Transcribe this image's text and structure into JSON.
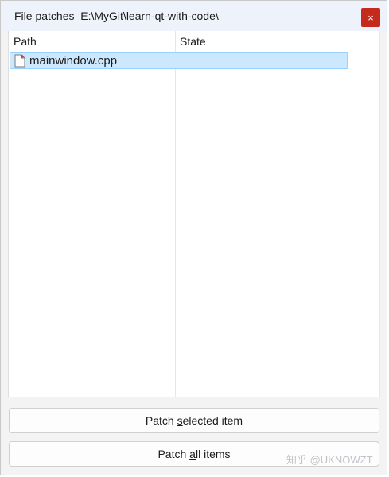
{
  "window": {
    "title_prefix": "File patches",
    "title_path": "E:\\MyGit\\learn-qt-with-code\\",
    "close_glyph": "×",
    "close_color": "#c42b1c"
  },
  "list": {
    "columns": [
      "Path",
      "State"
    ],
    "rows": [
      {
        "path": "mainwindow.cpp",
        "state": "",
        "icon": "modified-file-icon",
        "selected": true
      }
    ],
    "selection_color": "#cce8ff"
  },
  "buttons": {
    "patch_selected": {
      "before": "Patch ",
      "mnemonic": "s",
      "after": "elected item"
    },
    "patch_all": {
      "before": "Patch ",
      "mnemonic": "a",
      "after": "ll items"
    }
  },
  "watermark": "知乎 @UKNOWZT"
}
